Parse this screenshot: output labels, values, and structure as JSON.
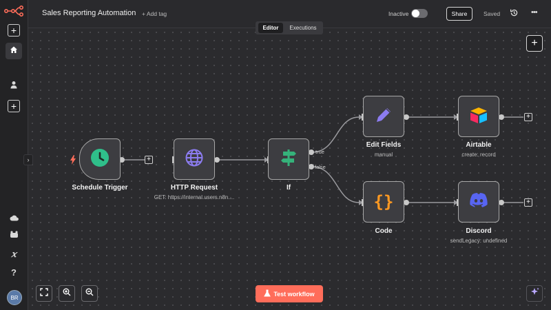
{
  "header": {
    "workflow_title": "Sales Reporting Automation",
    "add_tag": "+ Add tag",
    "status_label": "Inactive",
    "share_label": "Share",
    "saved_label": "Saved",
    "more_label": "•••"
  },
  "tabs": {
    "editor": "Editor",
    "executions": "Executions"
  },
  "sidebar": {
    "avatar_initials": "BR"
  },
  "nodes": {
    "schedule": {
      "label": "Schedule Trigger"
    },
    "http": {
      "label": "HTTP Request",
      "sub": "GET: https://internal.users.n8n...."
    },
    "if": {
      "label": "If"
    },
    "edit": {
      "label": "Edit Fields",
      "sub": "manual"
    },
    "airtable": {
      "label": "Airtable",
      "sub": "create: record"
    },
    "code": {
      "label": "Code"
    },
    "discord": {
      "label": "Discord",
      "sub": "sendLegacy: undefined"
    }
  },
  "edges": {
    "true_label": "true",
    "false_label": "false"
  },
  "footer": {
    "test_workflow": "Test workflow"
  },
  "colors": {
    "accent": "#ff6d5a",
    "canvas": "#2b2b2e",
    "node": "#3d3d41"
  }
}
